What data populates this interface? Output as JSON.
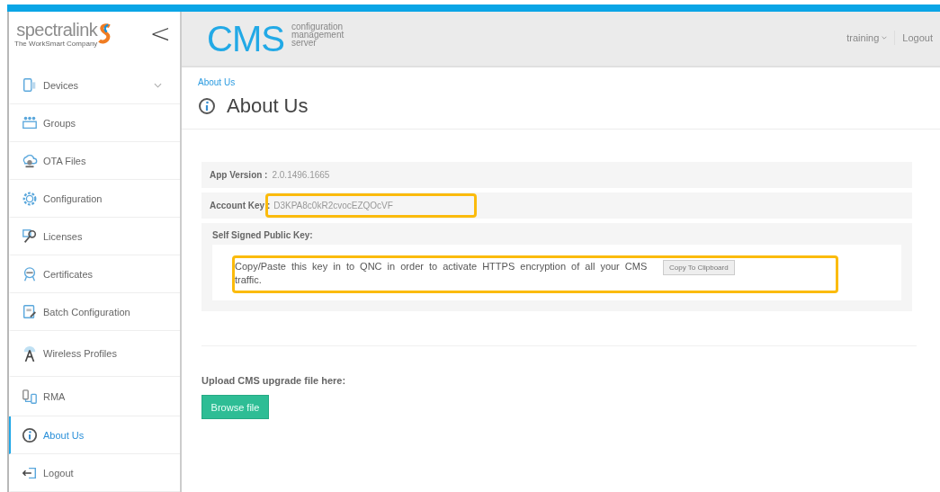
{
  "sidebar": {
    "logo": {
      "name": "spectralink",
      "tagline": "The WorkSmart Company"
    },
    "collapse_glyph": "<",
    "items": [
      {
        "label": "Devices",
        "expandable": true,
        "selected": false
      },
      {
        "label": "Groups",
        "expandable": false,
        "selected": false
      },
      {
        "label": "OTA Files",
        "expandable": false,
        "selected": false
      },
      {
        "label": "Configuration",
        "expandable": false,
        "selected": false
      },
      {
        "label": "Licenses",
        "expandable": false,
        "selected": false
      },
      {
        "label": "Certificates",
        "expandable": false,
        "selected": false
      },
      {
        "label": "Batch Configuration",
        "expandable": false,
        "selected": false
      },
      {
        "label": "Wireless Profiles",
        "expandable": false,
        "selected": false
      },
      {
        "label": "RMA",
        "expandable": false,
        "selected": false
      },
      {
        "label": "About Us",
        "expandable": false,
        "selected": true
      },
      {
        "label": "Logout",
        "expandable": false,
        "selected": false
      }
    ]
  },
  "header": {
    "brand": "CMS",
    "brand_lines": [
      "configuration",
      "management",
      "server"
    ],
    "user": "training",
    "logout": "Logout"
  },
  "breadcrumb": "About Us",
  "page_title": "About Us",
  "info_rows": [
    {
      "label": "App Version :",
      "value": "2.0.1496.1665",
      "highlighted": false
    },
    {
      "label": "Account Key :",
      "value": "D3KPA8c0kR2cvocEZQOcVF",
      "highlighted": true
    }
  ],
  "public_key": {
    "title": "Self Signed Public Key:",
    "text": "Copy/Paste this key in to QNC in order to activate HTTPS encryption of all your CMS traffic.",
    "button": "Copy To Clipboard",
    "highlighted": true
  },
  "upload": {
    "label": "Upload CMS upgrade file here:",
    "button": "Browse file"
  }
}
